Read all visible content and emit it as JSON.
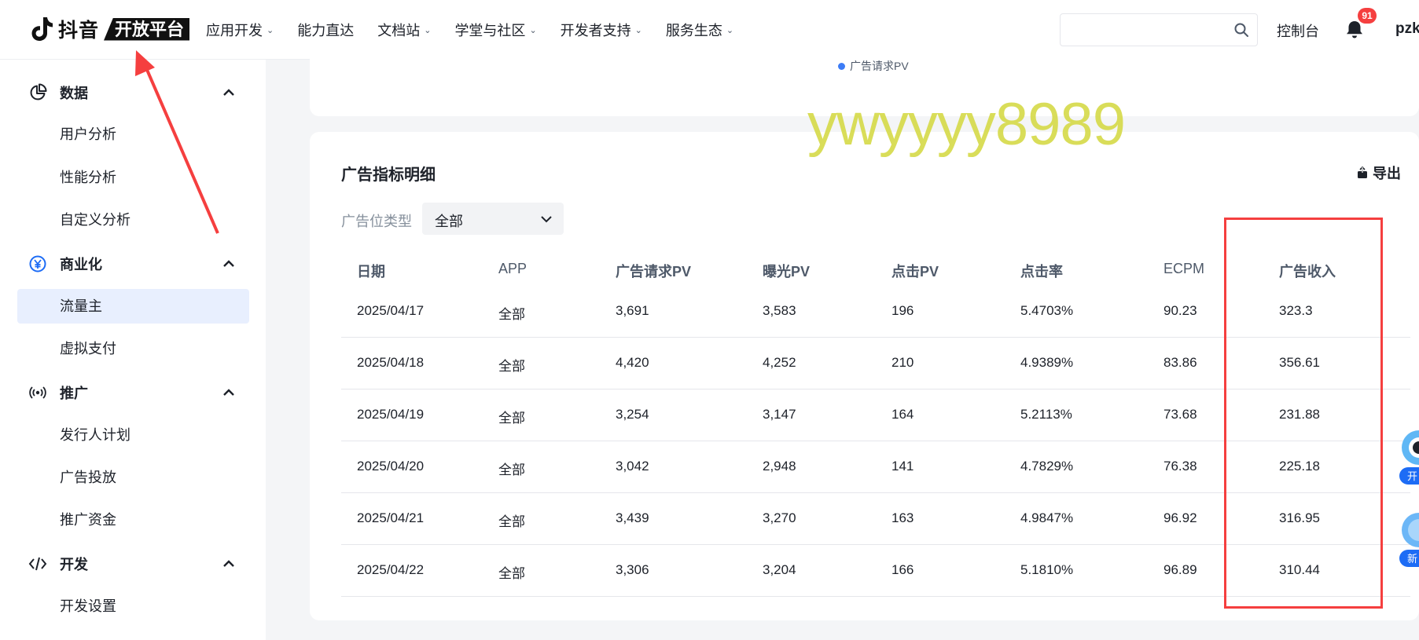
{
  "topnav": {
    "brand": "抖音",
    "platform": "开放平台",
    "items": [
      {
        "label": "应用开发",
        "has_dropdown": true
      },
      {
        "label": "能力直达",
        "has_dropdown": false
      },
      {
        "label": "文档站",
        "has_dropdown": true
      },
      {
        "label": "学堂与社区",
        "has_dropdown": true
      },
      {
        "label": "开发者支持",
        "has_dropdown": true
      },
      {
        "label": "服务生态",
        "has_dropdown": true
      }
    ],
    "search_placeholder": "",
    "console_label": "控制台",
    "notification_count": "91",
    "user_name": "pzk"
  },
  "sidebar": {
    "groups": [
      {
        "label": "数据",
        "icon": "pie-chart-icon",
        "items": [
          "用户分析",
          "性能分析",
          "自定义分析"
        ]
      },
      {
        "label": "商业化",
        "icon": "yen-circle-icon",
        "items": [
          "流量主",
          "虚拟支付"
        ]
      },
      {
        "label": "推广",
        "icon": "broadcast-icon",
        "items": [
          "发行人计划",
          "广告投放",
          "推广资金"
        ]
      },
      {
        "label": "开发",
        "icon": "code-icon",
        "items": [
          "开发设置"
        ]
      }
    ],
    "active_item": "流量主"
  },
  "chart_legend": {
    "series": "广告请求PV",
    "color": "#3c7cf6"
  },
  "watermark": "ywyyyy8989",
  "detail": {
    "title": "广告指标明细",
    "export_label": "导出",
    "filter_label": "广告位类型",
    "filter_value": "全部",
    "columns": [
      "日期",
      "APP",
      "广告请求PV",
      "曝光PV",
      "点击PV",
      "点击率",
      "ECPM",
      "广告收入"
    ],
    "rows": [
      [
        "2025/04/17",
        "全部",
        "3,691",
        "3,583",
        "196",
        "5.4703%",
        "90.23",
        "323.3"
      ],
      [
        "2025/04/18",
        "全部",
        "4,420",
        "4,252",
        "210",
        "4.9389%",
        "83.86",
        "356.61"
      ],
      [
        "2025/04/19",
        "全部",
        "3,254",
        "3,147",
        "164",
        "5.2113%",
        "73.68",
        "231.88"
      ],
      [
        "2025/04/20",
        "全部",
        "3,042",
        "2,948",
        "141",
        "4.7829%",
        "76.38",
        "225.18"
      ],
      [
        "2025/04/21",
        "全部",
        "3,439",
        "3,270",
        "163",
        "4.9847%",
        "96.92",
        "316.95"
      ],
      [
        "2025/04/22",
        "全部",
        "3,306",
        "3,204",
        "166",
        "5.1810%",
        "96.89",
        "310.44"
      ]
    ]
  },
  "floating": {
    "widget1": "开",
    "widget2": "新"
  },
  "colors": {
    "annotation": "#f53f3f",
    "active_bg": "#e8effe",
    "watermark": "#d2d73c"
  }
}
